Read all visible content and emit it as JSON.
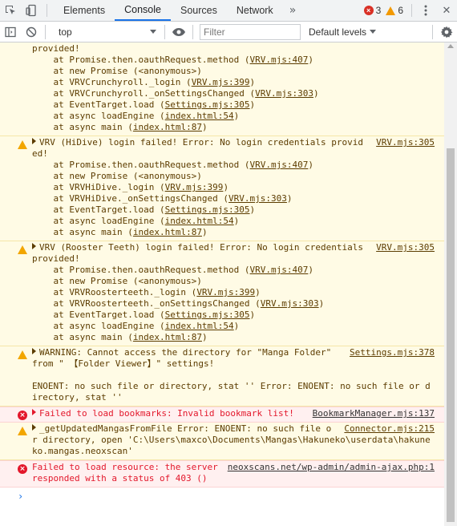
{
  "tabs": [
    {
      "label": "Elements"
    },
    {
      "label": "Console"
    },
    {
      "label": "Sources"
    },
    {
      "label": "Network"
    }
  ],
  "tabs_more": "»",
  "counts": {
    "errors": "3",
    "warnings": "6",
    "error_glyph": "×"
  },
  "close_glyph": "✕",
  "toolbar": {
    "context": "top",
    "filter_placeholder": "Filter",
    "levels": "Default levels"
  },
  "messages": [
    {
      "type": "warn",
      "partial": true,
      "head": "provided!",
      "lines": [
        {
          "pre": "    at Promise.then.oauthRequest.method (",
          "link": "VRV.mjs:407",
          "post": ")"
        },
        {
          "pre": "    at new Promise (<anonymous>)",
          "link": "",
          "post": ""
        },
        {
          "pre": "    at VRVCrunchyroll._login (",
          "link": "VRV.mjs:399",
          "post": ")"
        },
        {
          "pre": "    at VRVCrunchyroll._onSettingsChanged (",
          "link": "VRV.mjs:303",
          "post": ")"
        },
        {
          "pre": "    at EventTarget.load (",
          "link": "Settings.mjs:305",
          "post": ")"
        },
        {
          "pre": "    at async loadEngine (",
          "link": "index.html:54",
          "post": ")"
        },
        {
          "pre": "    at async main (",
          "link": "index.html:87",
          "post": ")"
        }
      ]
    },
    {
      "type": "warn",
      "source": "VRV.mjs:305",
      "head": "VRV (HiDive) login failed! Error: No login credentials provided!",
      "lines": [
        {
          "pre": "    at Promise.then.oauthRequest.method (",
          "link": "VRV.mjs:407",
          "post": ")"
        },
        {
          "pre": "    at new Promise (<anonymous>)",
          "link": "",
          "post": ""
        },
        {
          "pre": "    at VRVHiDive._login (",
          "link": "VRV.mjs:399",
          "post": ")"
        },
        {
          "pre": "    at VRVHiDive._onSettingsChanged (",
          "link": "VRV.mjs:303",
          "post": ")"
        },
        {
          "pre": "    at EventTarget.load (",
          "link": "Settings.mjs:305",
          "post": ")"
        },
        {
          "pre": "    at async loadEngine (",
          "link": "index.html:54",
          "post": ")"
        },
        {
          "pre": "    at async main (",
          "link": "index.html:87",
          "post": ")"
        }
      ]
    },
    {
      "type": "warn",
      "source": "VRV.mjs:305",
      "head": "VRV (Rooster Teeth) login failed! Error: No login credentials provided!",
      "lines": [
        {
          "pre": "    at Promise.then.oauthRequest.method (",
          "link": "VRV.mjs:407",
          "post": ")"
        },
        {
          "pre": "    at new Promise (<anonymous>)",
          "link": "",
          "post": ""
        },
        {
          "pre": "    at VRVRoosterteeth._login (",
          "link": "VRV.mjs:399",
          "post": ")"
        },
        {
          "pre": "    at VRVRoosterteeth._onSettingsChanged (",
          "link": "VRV.mjs:303",
          "post": ")"
        },
        {
          "pre": "    at EventTarget.load (",
          "link": "Settings.mjs:305",
          "post": ")"
        },
        {
          "pre": "    at async loadEngine (",
          "link": "index.html:54",
          "post": ")"
        },
        {
          "pre": "    at async main (",
          "link": "index.html:87",
          "post": ")"
        }
      ]
    },
    {
      "type": "warn",
      "source": "Settings.mjs:378",
      "head": "WARNING: Cannot access the directory for \"Manga Folder\" from \" 【Folder Viewer】\" settings!",
      "body": "\nENOENT: no such file or directory, stat '' Error: ENOENT: no such file or directory, stat ''"
    },
    {
      "type": "error",
      "source": "BookmarkManager.mjs:137",
      "head": "Failed to load bookmarks: Invalid bookmark list!"
    },
    {
      "type": "warn",
      "source": "Connector.mjs:215",
      "head": "_getUpdatedMangasFromFile Error: ENOENT: no such file or directory, open 'C:\\Users\\maxco\\Documents\\Mangas\\Hakuneko\\userdata\\hakuneko.mangas.neoxscan'"
    },
    {
      "type": "error",
      "source": "neoxscans.net/wp-admin/admin-ajax.php:1",
      "head": "Failed to load resource: the server responded with a status of 403 ()",
      "no_arrow": true
    }
  ],
  "prompt": "›"
}
